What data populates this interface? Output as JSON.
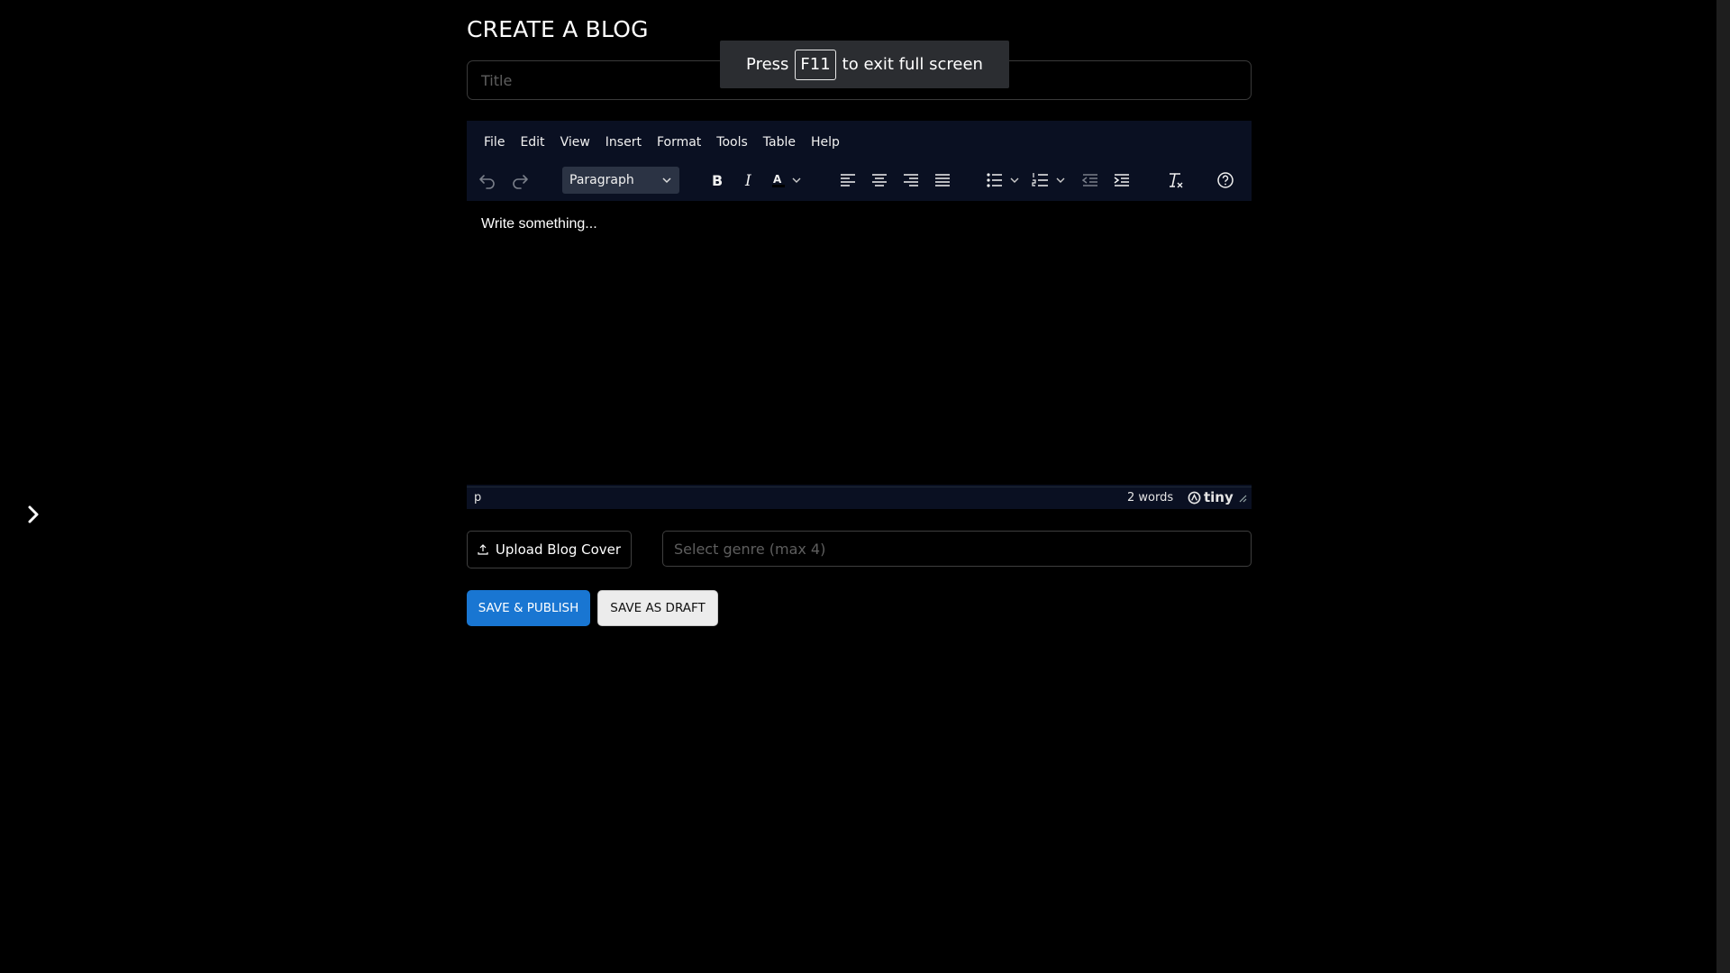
{
  "page": {
    "title": "CREATE A BLOG"
  },
  "title_field": {
    "placeholder": "Title",
    "value": ""
  },
  "fullscreen_notice": {
    "before": "Press",
    "key": "F11",
    "after": "to exit full screen"
  },
  "editor": {
    "menu": [
      "File",
      "Edit",
      "View",
      "Insert",
      "Format",
      "Tools",
      "Table",
      "Help"
    ],
    "block_format": "Paragraph",
    "toolbar_icons": [
      "undo-icon",
      "redo-icon",
      "bold-icon",
      "italic-icon",
      "text-color-icon",
      "align-left-icon",
      "align-center-icon",
      "align-right-icon",
      "justify-icon",
      "bullet-list-icon",
      "numbered-list-icon",
      "outdent-icon",
      "indent-icon",
      "clear-formatting-icon",
      "help-icon"
    ],
    "content": "Write something...",
    "status": {
      "path": "p",
      "word_count": "2 words",
      "brand": "tiny"
    }
  },
  "upload": {
    "label": "Upload Blog Cover"
  },
  "genre": {
    "placeholder": "Select genre (max 4)"
  },
  "actions": {
    "publish": "SAVE & PUBLISH",
    "draft": "SAVE AS DRAFT"
  },
  "colors": {
    "background": "#000000",
    "editor_chrome": "#0a1022",
    "primary": "#1976d2"
  }
}
